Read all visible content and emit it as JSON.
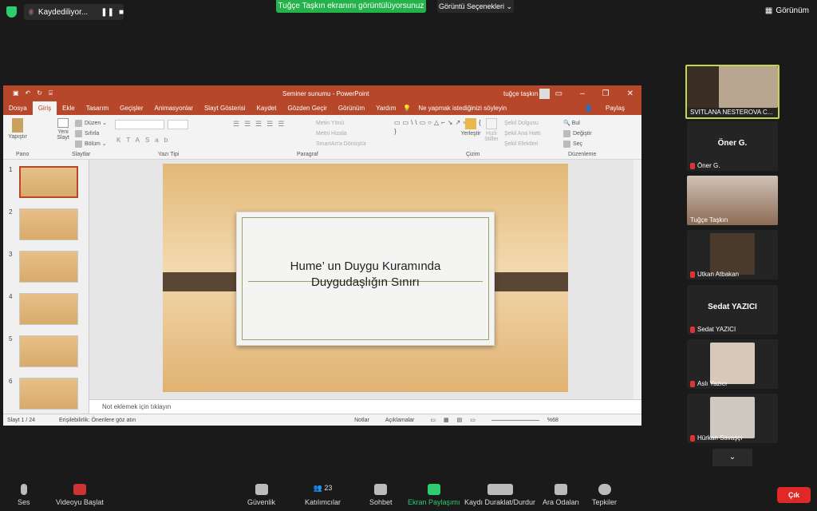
{
  "top": {
    "recording": "Kaydediliyor...",
    "share_banner": "Tuğçe Taşkın ekranını görüntülüyorsunuz",
    "view_options": "Görüntü Seçenekleri",
    "view": "Görünüm"
  },
  "ppt": {
    "doc_title": "Seminer sunumu  -  PowerPoint",
    "user": "tuğçe taşkın",
    "menu": [
      "Dosya",
      "Giriş",
      "Ekle",
      "Tasarım",
      "Geçişler",
      "Animasyonlar",
      "Slayt Gösterisi",
      "Kaydet",
      "Gözden Geçir",
      "Görünüm",
      "Yardım",
      "Ne yapmak istediğinizi söyleyin"
    ],
    "share": "Paylaş",
    "ribbon": {
      "paste": "Yapıştır",
      "new_slide": "Yeni Slayt",
      "edit": "Düzen",
      "reset": "Sıfırla",
      "section": "Bölüm",
      "text_dir": "Metin Yönü",
      "align_text": "Metni Hizala",
      "smartart": "SmartArt'a Dönüştür",
      "arrange": "Yerleştir",
      "quick_styles": "Hızlı Stiller",
      "fill": "Şekil Dolgusu",
      "outline": "Şekil Ana Hattı",
      "effects": "Şekil Efektleri",
      "find": "Bul",
      "replace": "Değiştir",
      "select": "Seç",
      "groups": {
        "clipboard": "Pano",
        "slides": "Slaytlar",
        "font": "Yazı Tipi",
        "paragraph": "Paragraf",
        "drawing": "Çizim",
        "editing": "Düzenleme"
      }
    },
    "slide_title": "Hume’ un Duygu Kuramında Duygudaşlığın Sınırı",
    "notes_placeholder": "Not eklemek için tıklayın",
    "status": {
      "slide": "Slayt 1 / 24",
      "access": "Erişilebilirlik: Önerilere göz atın",
      "notes": "Notlar",
      "comments": "Açıklamalar",
      "zoom": "%68"
    },
    "thumb_numbers": [
      "1",
      "2",
      "3",
      "4",
      "5",
      "6"
    ]
  },
  "participants": [
    {
      "name": "SVITLANA NESTEROVA C..."
    },
    {
      "name": "Öner G.",
      "big": "Öner G."
    },
    {
      "name": "Tuğçe Taşkın"
    },
    {
      "name": "Utkan Atbakan"
    },
    {
      "name": "Sedat YAZICI",
      "big": "Sedat YAZICI"
    },
    {
      "name": "Aslı Yazıcı"
    },
    {
      "name": "Hürkan Savaşçı"
    }
  ],
  "bottom": {
    "audio": "Ses",
    "video": "Videoyu Başlat",
    "security": "Güvenlik",
    "participants": "Katılımcılar",
    "participant_count": "23",
    "chat": "Sohbet",
    "share": "Ekran Paylaşımı",
    "pause_rec": "Kaydı Duraklat/Durdur",
    "breakout": "Ara Odaları",
    "reactions": "Tepkiler",
    "end": "Çık"
  }
}
